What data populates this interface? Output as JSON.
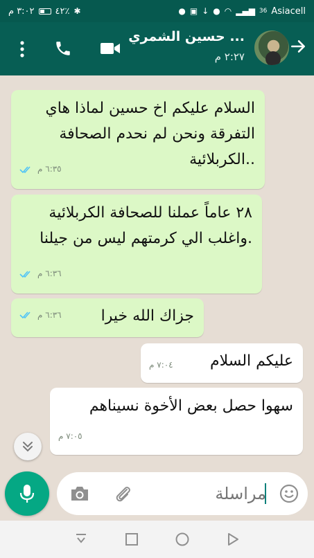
{
  "status_bar": {
    "carrier": "Asiacell",
    "signal_label": "36",
    "time": "٣:٠٢ م",
    "battery": "٤٢٪"
  },
  "header": {
    "contact_name": "حسين الشمري ...",
    "last_seen": "٢:٢٧ م"
  },
  "messages": [
    {
      "direction": "outgoing",
      "text": "السلام عليكم اخ حسين لماذا هاي التفرقة ونحن لم نحدم الصحافة الكربلائية..",
      "time": "٦:٣٥ م",
      "read": true
    },
    {
      "direction": "outgoing",
      "text": "٢٨ عاماً عملنا للصحافة الكربلائية واغلب الي كرمتهم ليس من جيلنا.",
      "time": "٦:٣٦ م",
      "read": true
    },
    {
      "direction": "outgoing",
      "text": "جزاك الله خيرا",
      "time": "٦:٣٦ م",
      "read": true
    },
    {
      "direction": "incoming",
      "text": "عليكم السلام",
      "time": "٧:٠٤ م"
    },
    {
      "direction": "incoming",
      "text": "سهوا حصل بعض الأخوة نسيناهم",
      "time": "٧:٠٥ م"
    }
  ],
  "composer": {
    "placeholder": "مراسلة"
  },
  "colors": {
    "header": "#075e54",
    "status_bar": "#06594f",
    "outgoing_bubble": "#dcf8c6",
    "incoming_bubble": "#ffffff",
    "accent": "#05a884",
    "read_ticks": "#4fc3f7"
  },
  "icons": {
    "back": "arrow-right-icon",
    "video": "video-camera-icon",
    "call": "phone-icon",
    "more": "more-vertical-icon",
    "emoji": "emoji-icon",
    "attach": "paperclip-icon",
    "camera": "camera-icon",
    "mic": "microphone-icon",
    "scroll": "chevrons-down-icon"
  }
}
